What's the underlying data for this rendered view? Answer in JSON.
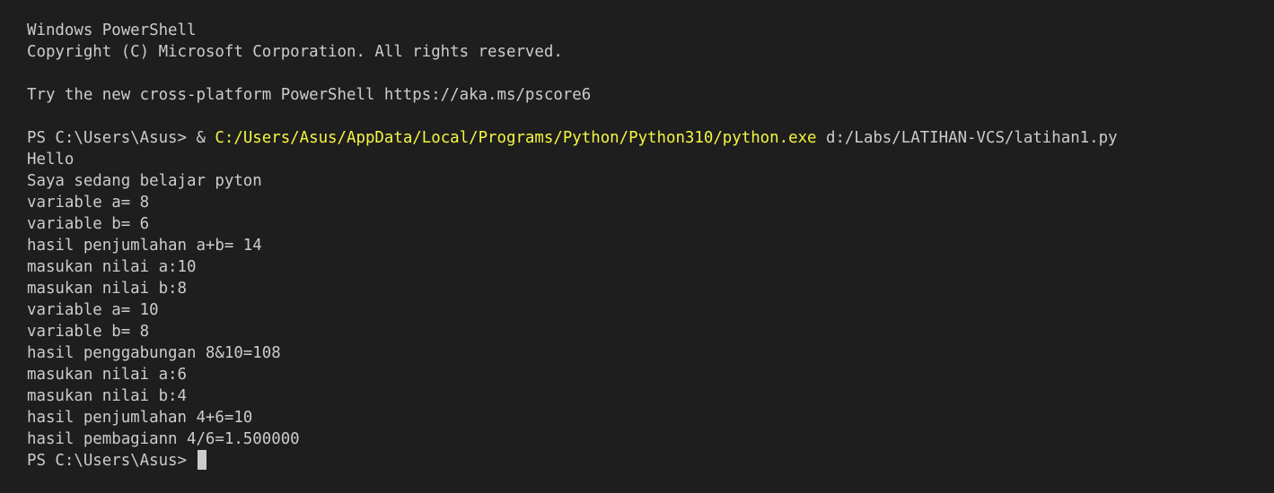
{
  "header": {
    "title": "Windows PowerShell",
    "copyright": "Copyright (C) Microsoft Corporation. All rights reserved.",
    "tip": "Try the new cross-platform PowerShell https://aka.ms/pscore6"
  },
  "command": {
    "prompt": "PS C:\\Users\\Asus> ",
    "operator": "& ",
    "executable": "C:/Users/Asus/AppData/Local/Programs/Python/Python310/python.exe",
    "args": " d:/Labs/LATIHAN-VCS/latihan1.py"
  },
  "output": [
    "Hello",
    "Saya sedang belajar pyton",
    "variable a= 8",
    "variable b= 6",
    "hasil penjumlahan a+b= 14",
    "masukan nilai a:10",
    "masukan nilai b:8",
    "variable a= 10",
    "variable b= 8",
    "hasil penggabungan 8&10=108",
    "masukan nilai a:6",
    "masukan nilai b:4",
    "hasil penjumlahan 4+6=10",
    "hasil pembagiann 4/6=1.500000"
  ],
  "final_prompt": "PS C:\\Users\\Asus> ",
  "colors": {
    "background": "#1e1e1e",
    "foreground": "#cccccc",
    "executable": "#f5f543"
  }
}
